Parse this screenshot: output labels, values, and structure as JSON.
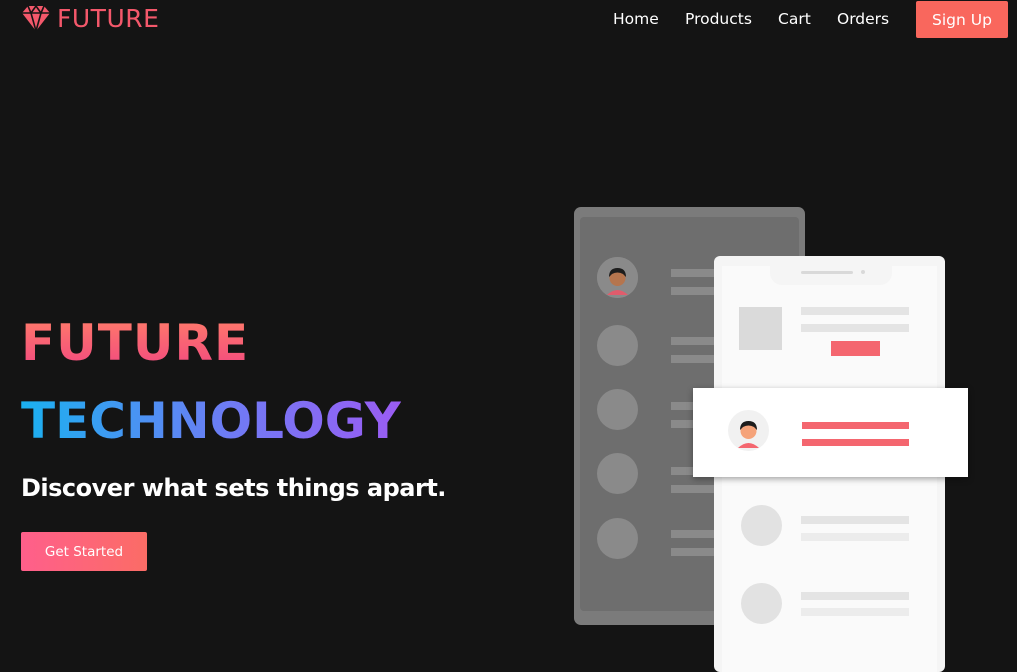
{
  "brand": {
    "name": "FUTURE",
    "accent": "#f4586b"
  },
  "nav": {
    "links": [
      "Home",
      "Products",
      "Cart",
      "Orders"
    ],
    "signup_label": "Sign Up",
    "signup_color": "#f9675d"
  },
  "hero": {
    "title_line1": "FUTURE",
    "title_line2": "TECHNOLOGY",
    "subtitle": "Discover what sets things apart.",
    "cta_label": "Get Started"
  },
  "colors": {
    "background": "#141414",
    "title1_gradient": [
      "#ff7a6a",
      "#f24a7f"
    ],
    "title2_gradient": [
      "#1ab1f0",
      "#6f7bf5",
      "#9b5cf3"
    ],
    "cta_gradient": [
      "#ff5f8b",
      "#fb6c66"
    ]
  },
  "icons": {
    "logo": "diamond-icon",
    "avatar": "person-avatar-icon"
  }
}
